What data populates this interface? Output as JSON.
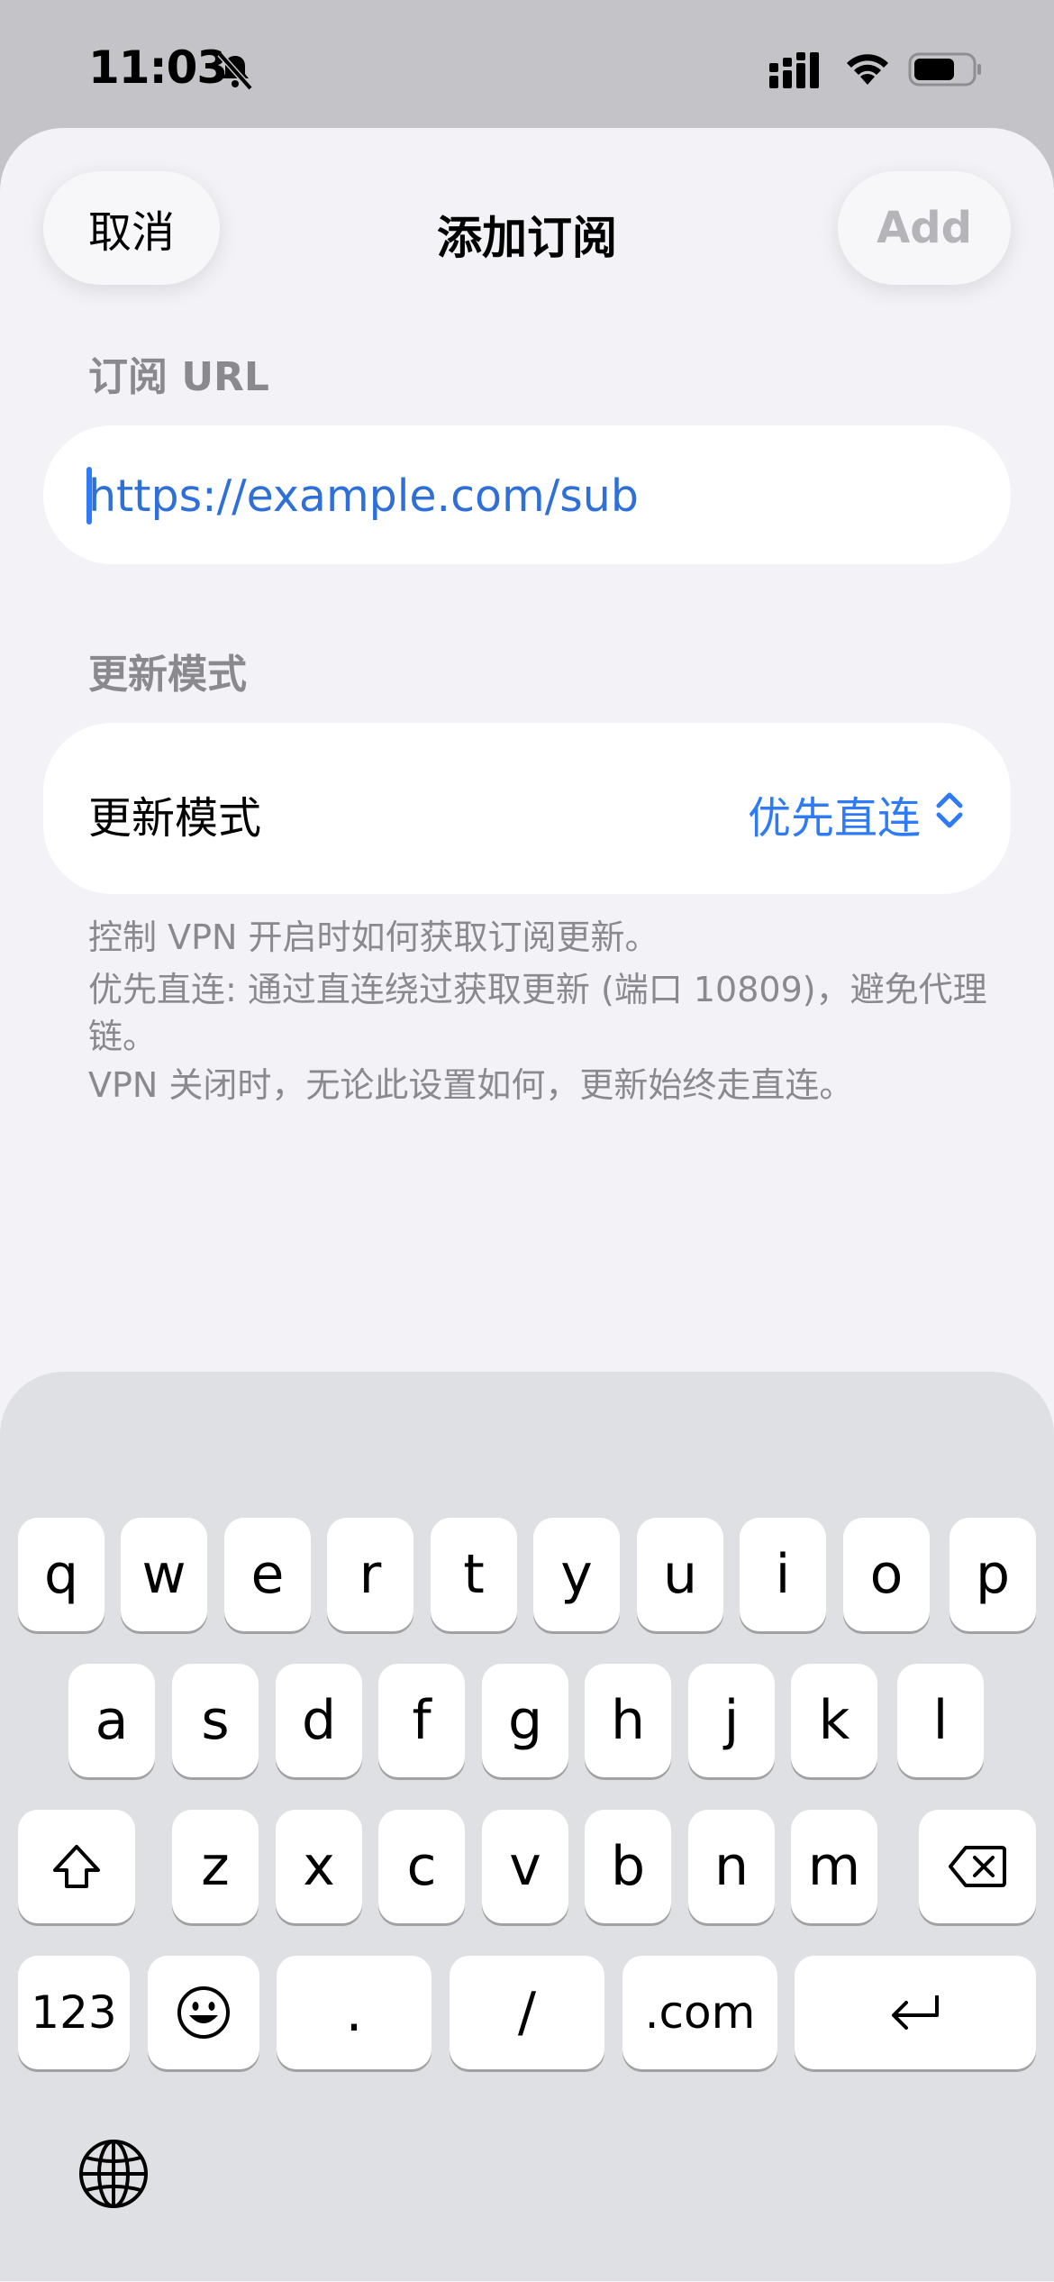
{
  "status_bar": {
    "time": "11:03"
  },
  "nav": {
    "cancel_label": "取消",
    "title": "添加订阅",
    "add_label": "Add"
  },
  "url_section": {
    "label": "订阅 URL",
    "value": "https://example.com/sub"
  },
  "mode_section": {
    "header": "更新模式",
    "row_label": "更新模式",
    "row_value": "优先直连"
  },
  "footnotes": [
    "控制 VPN 开启时如何获取订阅更新。",
    "优先直连: 通过直连绕过获取更新 (端口 10809)，避免代理链。",
    "VPN 关闭时，无论此设置如何，更新始终走直连。"
  ],
  "keyboard": {
    "row1": [
      "q",
      "w",
      "e",
      "r",
      "t",
      "y",
      "u",
      "i",
      "o",
      "p"
    ],
    "row2": [
      "a",
      "s",
      "d",
      "f",
      "g",
      "h",
      "j",
      "k",
      "l"
    ],
    "row3": [
      "z",
      "x",
      "c",
      "v",
      "b",
      "n",
      "m"
    ],
    "numbers_label": "123",
    "dot_label": ".",
    "slash_label": "/",
    "dotcom_label": ".com"
  },
  "colors": {
    "accent": "#2f7bf6",
    "sheet_bg": "#f2f2f7",
    "keyboard_bg": "#dfe0e4"
  }
}
